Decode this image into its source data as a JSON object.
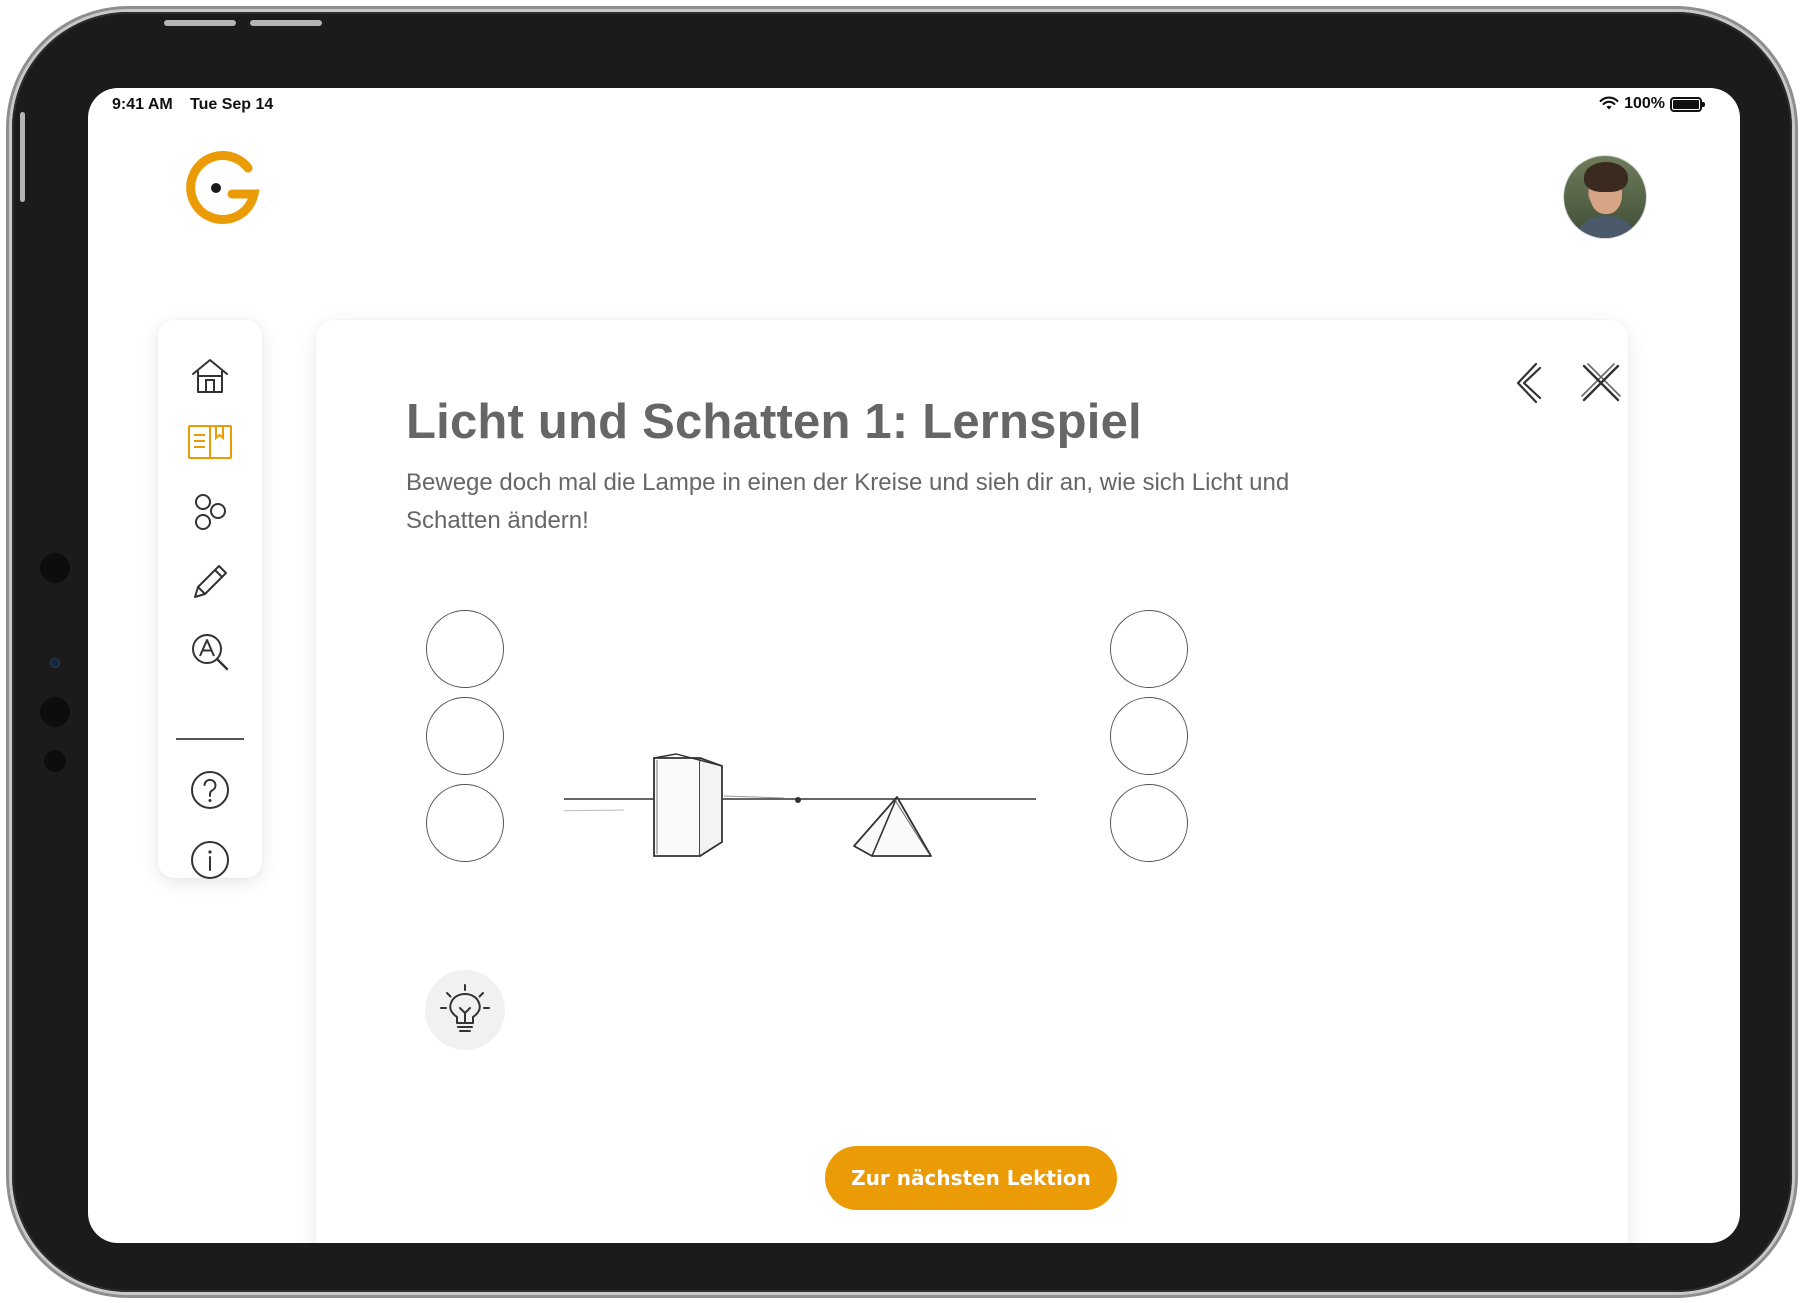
{
  "status_bar": {
    "time": "9:41 AM",
    "date": "Tue Sep 14",
    "battery": "100%",
    "wifi_icon": "wifi-icon",
    "battery_icon": "battery-icon"
  },
  "brand": {
    "logo_icon": "g-logo-icon",
    "accent_color": "#eb9b06"
  },
  "user": {
    "avatar_icon": "user-avatar-photo"
  },
  "sidebar": {
    "items": [
      {
        "icon": "home-icon",
        "active": false
      },
      {
        "icon": "book-icon",
        "active": true
      },
      {
        "icon": "molecule-icon",
        "active": false
      },
      {
        "icon": "pencil-icon",
        "active": false
      },
      {
        "icon": "search-letter-icon",
        "active": false
      },
      {
        "icon": "help-icon",
        "active": false
      },
      {
        "icon": "info-icon",
        "active": false
      }
    ]
  },
  "lesson": {
    "title": "Licht und Schatten 1: Lernspiel",
    "description": "Bewege doch mal die Lampe in einen der Kreise und sieh dir an, wie sich Licht und Schatten ändern!",
    "back_icon": "chevron-left-icon",
    "close_icon": "close-icon",
    "hint_icon": "lightbulb-icon",
    "next_button_label": "Zur nächsten Lektion"
  },
  "colors": {
    "text_gray": "#666666",
    "accent": "#eb9b06",
    "hint_bg": "#f1f1f1"
  }
}
